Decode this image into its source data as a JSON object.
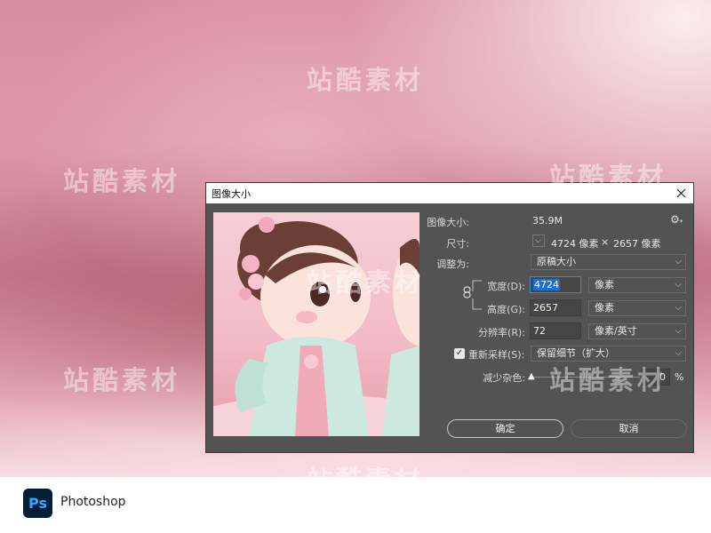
{
  "watermark": "站酷素材",
  "dialog": {
    "title": "图像大小",
    "image_size": {
      "label": "图像大小:",
      "value": "35.9M"
    },
    "dimensions": {
      "label": "尺寸:",
      "width": "4724 像素",
      "times": "×",
      "height": "2657 像素"
    },
    "fit_to": {
      "label": "调整为:",
      "value": "原稿大小"
    },
    "width": {
      "label": "宽度(D):",
      "value": "4724",
      "unit": "像素"
    },
    "height": {
      "label": "高度(G):",
      "value": "2657",
      "unit": "像素"
    },
    "resolution": {
      "label": "分辨率(R):",
      "value": "72",
      "unit": "像素/英寸"
    },
    "resample": {
      "label": "重新采样(S):",
      "checked": true,
      "value": "保留细节（扩大）"
    },
    "noise": {
      "label": "减少杂色:",
      "value": "0",
      "unit": "%",
      "level": 0
    },
    "ok_label": "确定",
    "cancel_label": "取消"
  },
  "footer": {
    "app_icon_text": "Ps",
    "app_name": "Photoshop"
  },
  "colors": {
    "dialog_bg": "#535353",
    "accent": "#1f6fd0",
    "ps_blue": "#31a8ff",
    "ps_dark": "#031e36"
  }
}
